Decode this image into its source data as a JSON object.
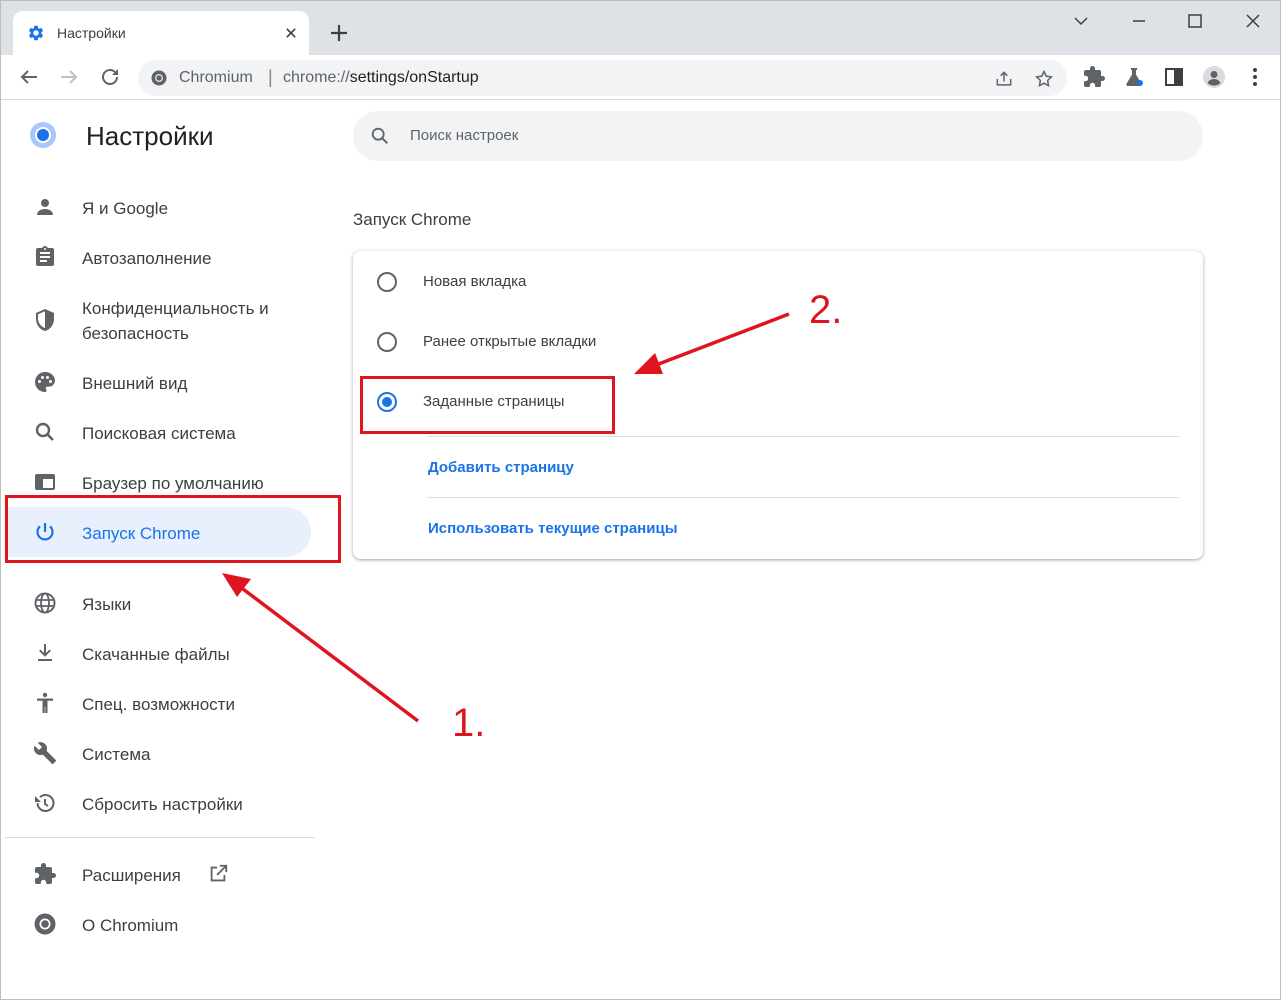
{
  "browser": {
    "tab_title": "Настройки",
    "omnibox_host": "Chromium",
    "omnibox_separator": "|",
    "omnibox_url_scheme": "chrome://",
    "omnibox_url_rest": "settings/onStartup"
  },
  "page": {
    "title": "Настройки",
    "search_placeholder": "Поиск настроек"
  },
  "sidebar": {
    "items": [
      {
        "label": "Я и Google",
        "icon": "person-icon"
      },
      {
        "label": "Автозаполнение",
        "icon": "clipboard-icon"
      },
      {
        "label": "Конфиденциальность и",
        "label2": "безопасность",
        "icon": "shield-icon"
      },
      {
        "label": "Внешний вид",
        "icon": "palette-icon"
      },
      {
        "label": "Поисковая система",
        "icon": "search-icon"
      },
      {
        "label": "Браузер по умолчанию",
        "icon": "browser-icon"
      },
      {
        "label": "Запуск Chrome",
        "icon": "power-icon",
        "active": true
      },
      {
        "label": "Языки",
        "icon": "globe-icon"
      },
      {
        "label": "Скачанные файлы",
        "icon": "download-icon"
      },
      {
        "label": "Спец. возможности",
        "icon": "accessibility-icon"
      },
      {
        "label": "Система",
        "icon": "wrench-icon"
      },
      {
        "label": "Сбросить настройки",
        "icon": "restore-icon"
      }
    ],
    "extensions_label": "Расширения",
    "about_label": "О Chromium"
  },
  "startup": {
    "section_title": "Запуск Chrome",
    "options": [
      {
        "label": "Новая вкладка",
        "checked": false
      },
      {
        "label": "Ранее открытые вкладки",
        "checked": false
      },
      {
        "label": "Заданные страницы",
        "checked": true
      }
    ],
    "add_page_link": "Добавить страницу",
    "use_current_link": "Использовать текущие страницы"
  },
  "annotations": {
    "step1": "1.",
    "step2": "2.",
    "color": "#e0141e"
  },
  "colors": {
    "accent": "#1a73e8",
    "active_bg": "#e8f0fe",
    "tabstrip_bg": "#dee1e6"
  }
}
